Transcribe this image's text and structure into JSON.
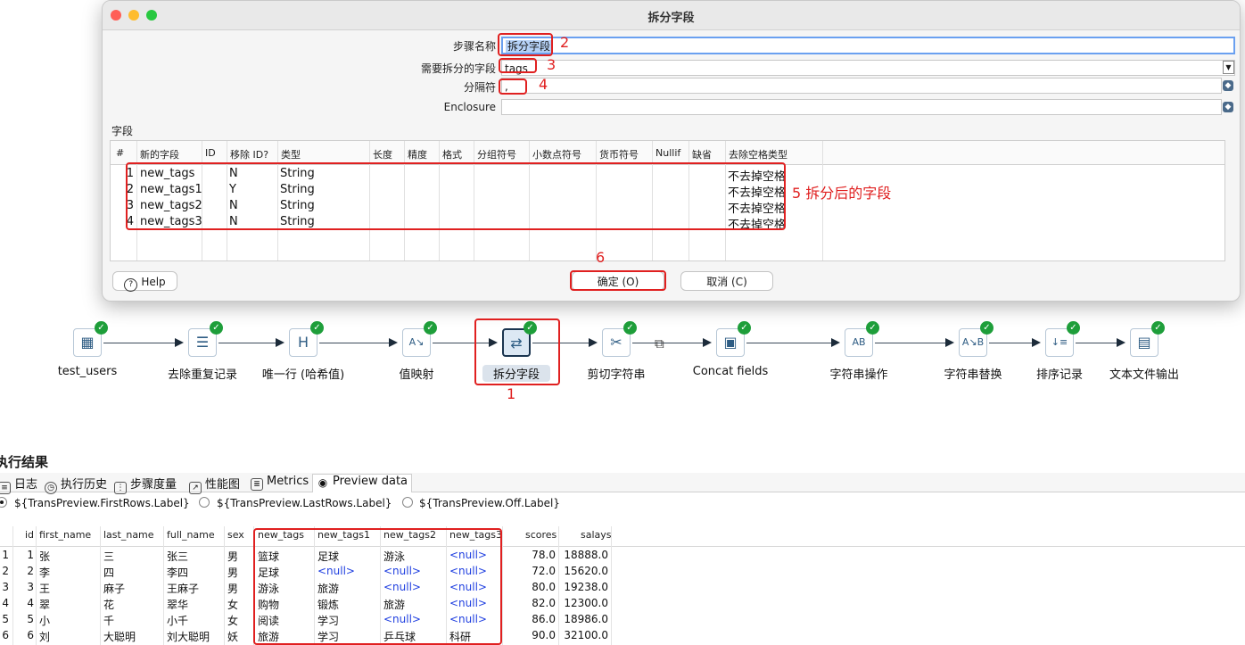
{
  "dialog": {
    "title": "拆分字段",
    "step_name_label": "步骤名称",
    "step_name_value": "拆分字段",
    "split_field_label": "需要拆分的字段",
    "split_field_value": "tags",
    "delimiter_label": "分隔符",
    "delimiter_value": ",",
    "enclosure_label": "Enclosure",
    "enclosure_value": "",
    "fields_section_label": "字段",
    "grid_headers": [
      "#",
      "新的字段",
      "ID",
      "移除 ID?",
      "类型",
      "长度",
      "精度",
      "格式",
      "分组符号",
      "小数点符号",
      "货币符号",
      "Nullif",
      "缺省",
      "去除空格类型"
    ],
    "grid_rows": [
      {
        "num": "1",
        "name": "new_tags",
        "remove_id": "N",
        "type": "String",
        "trim": "不去掉空格"
      },
      {
        "num": "2",
        "name": "new_tags1",
        "remove_id": "Y",
        "type": "String",
        "trim": "不去掉空格"
      },
      {
        "num": "3",
        "name": "new_tags2",
        "remove_id": "N",
        "type": "String",
        "trim": "不去掉空格"
      },
      {
        "num": "4",
        "name": "new_tags3",
        "remove_id": "N",
        "type": "String",
        "trim": "不去掉空格"
      }
    ],
    "help_label": "Help",
    "ok_label": "确定 (O)",
    "cancel_label": "取消 (C)"
  },
  "annotations": {
    "a1": "1",
    "a2": "2",
    "a3": "3",
    "a4": "4",
    "a5": "5 拆分后的字段",
    "a6": "6"
  },
  "flow": {
    "steps": [
      {
        "label": "test_users",
        "icon": "table-input-icon"
      },
      {
        "label": "去除重复记录",
        "icon": "unique-rows-icon"
      },
      {
        "label": "唯一行 (哈希值)",
        "icon": "hash-unique-icon"
      },
      {
        "label": "值映射",
        "icon": "value-mapper-icon"
      },
      {
        "label": "拆分字段",
        "icon": "split-fields-icon"
      },
      {
        "label": "剪切字符串",
        "icon": "cut-string-icon"
      },
      {
        "label": "Concat fields",
        "icon": "concat-fields-icon"
      },
      {
        "label": "字符串操作",
        "icon": "string-operations-icon"
      },
      {
        "label": "字符串替换",
        "icon": "replace-string-icon"
      },
      {
        "label": "排序记录",
        "icon": "sort-rows-icon"
      },
      {
        "label": "文本文件输出",
        "icon": "text-output-icon"
      }
    ]
  },
  "results": {
    "title": "执行结果",
    "tabs": [
      "日志",
      "执行历史",
      "步骤度量",
      "性能图",
      "Metrics",
      "Preview data"
    ],
    "radio_options": [
      "${TransPreview.FirstRows.Label}",
      "${TransPreview.LastRows.Label}",
      "${TransPreview.Off.Label}"
    ],
    "columns": [
      "id",
      "first_name",
      "last_name",
      "full_name",
      "sex",
      "new_tags",
      "new_tags1",
      "new_tags2",
      "new_tags3",
      "scores",
      "salays"
    ],
    "rows": [
      [
        "1",
        "1",
        "张",
        "三",
        "张三",
        "男",
        "篮球",
        "足球",
        "游泳",
        "<null>",
        "78.0",
        "18888.0"
      ],
      [
        "2",
        "2",
        "李",
        "四",
        "李四",
        "男",
        "足球",
        "<null>",
        "<null>",
        "<null>",
        "72.0",
        "15620.0"
      ],
      [
        "3",
        "3",
        "王",
        "麻子",
        "王麻子",
        "男",
        "游泳",
        "旅游",
        "<null>",
        "<null>",
        "80.0",
        "19238.0"
      ],
      [
        "4",
        "4",
        "翠",
        "花",
        "翠华",
        "女",
        "购物",
        "锻炼",
        "旅游",
        "<null>",
        "82.0",
        "12300.0"
      ],
      [
        "5",
        "5",
        "小",
        "千",
        "小千",
        "女",
        "阅读",
        "学习",
        "<null>",
        "<null>",
        "86.0",
        "18986.0"
      ],
      [
        "6",
        "6",
        "刘",
        "大聪明",
        "刘大聪明",
        "妖",
        "旅游",
        "学习",
        "乒乓球",
        "科研",
        "90.0",
        "32100.0"
      ]
    ]
  },
  "colors": {
    "annotation": "#e02020",
    "null_value": "#1f3fe0",
    "ok_check": "#1e9e3a"
  }
}
